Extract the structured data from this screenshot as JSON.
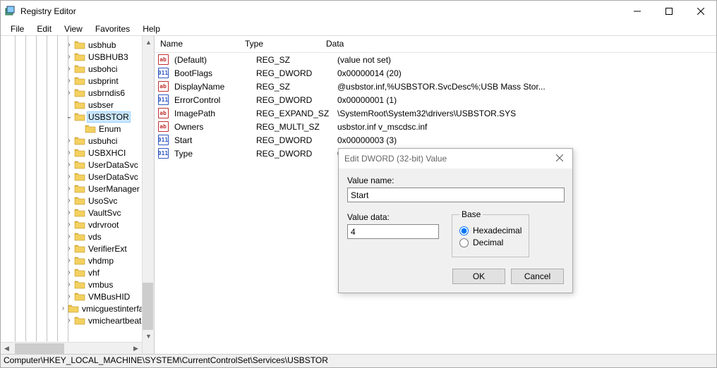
{
  "window": {
    "title": "Registry Editor"
  },
  "menu": {
    "file": "File",
    "edit": "Edit",
    "view": "View",
    "favorites": "Favorites",
    "help": "Help"
  },
  "tree": {
    "items": [
      {
        "indent": 6,
        "exp": ">",
        "label": "usbhub"
      },
      {
        "indent": 6,
        "exp": ">",
        "label": "USBHUB3"
      },
      {
        "indent": 6,
        "exp": ">",
        "label": "usbohci"
      },
      {
        "indent": 6,
        "exp": ">",
        "label": "usbprint"
      },
      {
        "indent": 6,
        "exp": ">",
        "label": "usbrndis6"
      },
      {
        "indent": 6,
        "exp": "",
        "label": "usbser"
      },
      {
        "indent": 6,
        "exp": "v",
        "label": "USBSTOR",
        "selected": true
      },
      {
        "indent": 7,
        "exp": "",
        "label": "Enum"
      },
      {
        "indent": 6,
        "exp": ">",
        "label": "usbuhci"
      },
      {
        "indent": 6,
        "exp": ">",
        "label": "USBXHCI"
      },
      {
        "indent": 6,
        "exp": ">",
        "label": "UserDataSvc"
      },
      {
        "indent": 6,
        "exp": ">",
        "label": "UserDataSvc"
      },
      {
        "indent": 6,
        "exp": ">",
        "label": "UserManager"
      },
      {
        "indent": 6,
        "exp": ">",
        "label": "UsoSvc"
      },
      {
        "indent": 6,
        "exp": ">",
        "label": "VaultSvc"
      },
      {
        "indent": 6,
        "exp": ">",
        "label": "vdrvroot"
      },
      {
        "indent": 6,
        "exp": ">",
        "label": "vds"
      },
      {
        "indent": 6,
        "exp": ">",
        "label": "VerifierExt"
      },
      {
        "indent": 6,
        "exp": ">",
        "label": "vhdmp"
      },
      {
        "indent": 6,
        "exp": ">",
        "label": "vhf"
      },
      {
        "indent": 6,
        "exp": ">",
        "label": "vmbus"
      },
      {
        "indent": 6,
        "exp": ">",
        "label": "VMBusHID"
      },
      {
        "indent": 6,
        "exp": ">",
        "label": "vmicguestinterface"
      },
      {
        "indent": 6,
        "exp": ">",
        "label": "vmicheartbeat"
      }
    ]
  },
  "list": {
    "headers": {
      "name": "Name",
      "type": "Type",
      "data": "Data"
    },
    "rows": [
      {
        "icon": "sz",
        "name": "(Default)",
        "type": "REG_SZ",
        "data": "(value not set)"
      },
      {
        "icon": "dw",
        "name": "BootFlags",
        "type": "REG_DWORD",
        "data": "0x00000014 (20)"
      },
      {
        "icon": "sz",
        "name": "DisplayName",
        "type": "REG_SZ",
        "data": "@usbstor.inf,%USBSTOR.SvcDesc%;USB Mass Stor..."
      },
      {
        "icon": "dw",
        "name": "ErrorControl",
        "type": "REG_DWORD",
        "data": "0x00000001 (1)"
      },
      {
        "icon": "sz",
        "name": "ImagePath",
        "type": "REG_EXPAND_SZ",
        "data": "\\SystemRoot\\System32\\drivers\\USBSTOR.SYS"
      },
      {
        "icon": "sz",
        "name": "Owners",
        "type": "REG_MULTI_SZ",
        "data": "usbstor.inf v_mscdsc.inf"
      },
      {
        "icon": "dw",
        "name": "Start",
        "type": "REG_DWORD",
        "data": "0x00000003 (3)"
      },
      {
        "icon": "dw",
        "name": "Type",
        "type": "REG_DWORD",
        "data": "0x"
      }
    ]
  },
  "statusbar": {
    "path": "Computer\\HKEY_LOCAL_MACHINE\\SYSTEM\\CurrentControlSet\\Services\\USBSTOR"
  },
  "dialog": {
    "title": "Edit DWORD (32-bit) Value",
    "valueNameLabel": "Value name:",
    "valueName": "Start",
    "valueDataLabel": "Value data:",
    "valueData": "4",
    "baseLabel": "Base",
    "hexLabel": "Hexadecimal",
    "decLabel": "Decimal",
    "ok": "OK",
    "cancel": "Cancel"
  }
}
